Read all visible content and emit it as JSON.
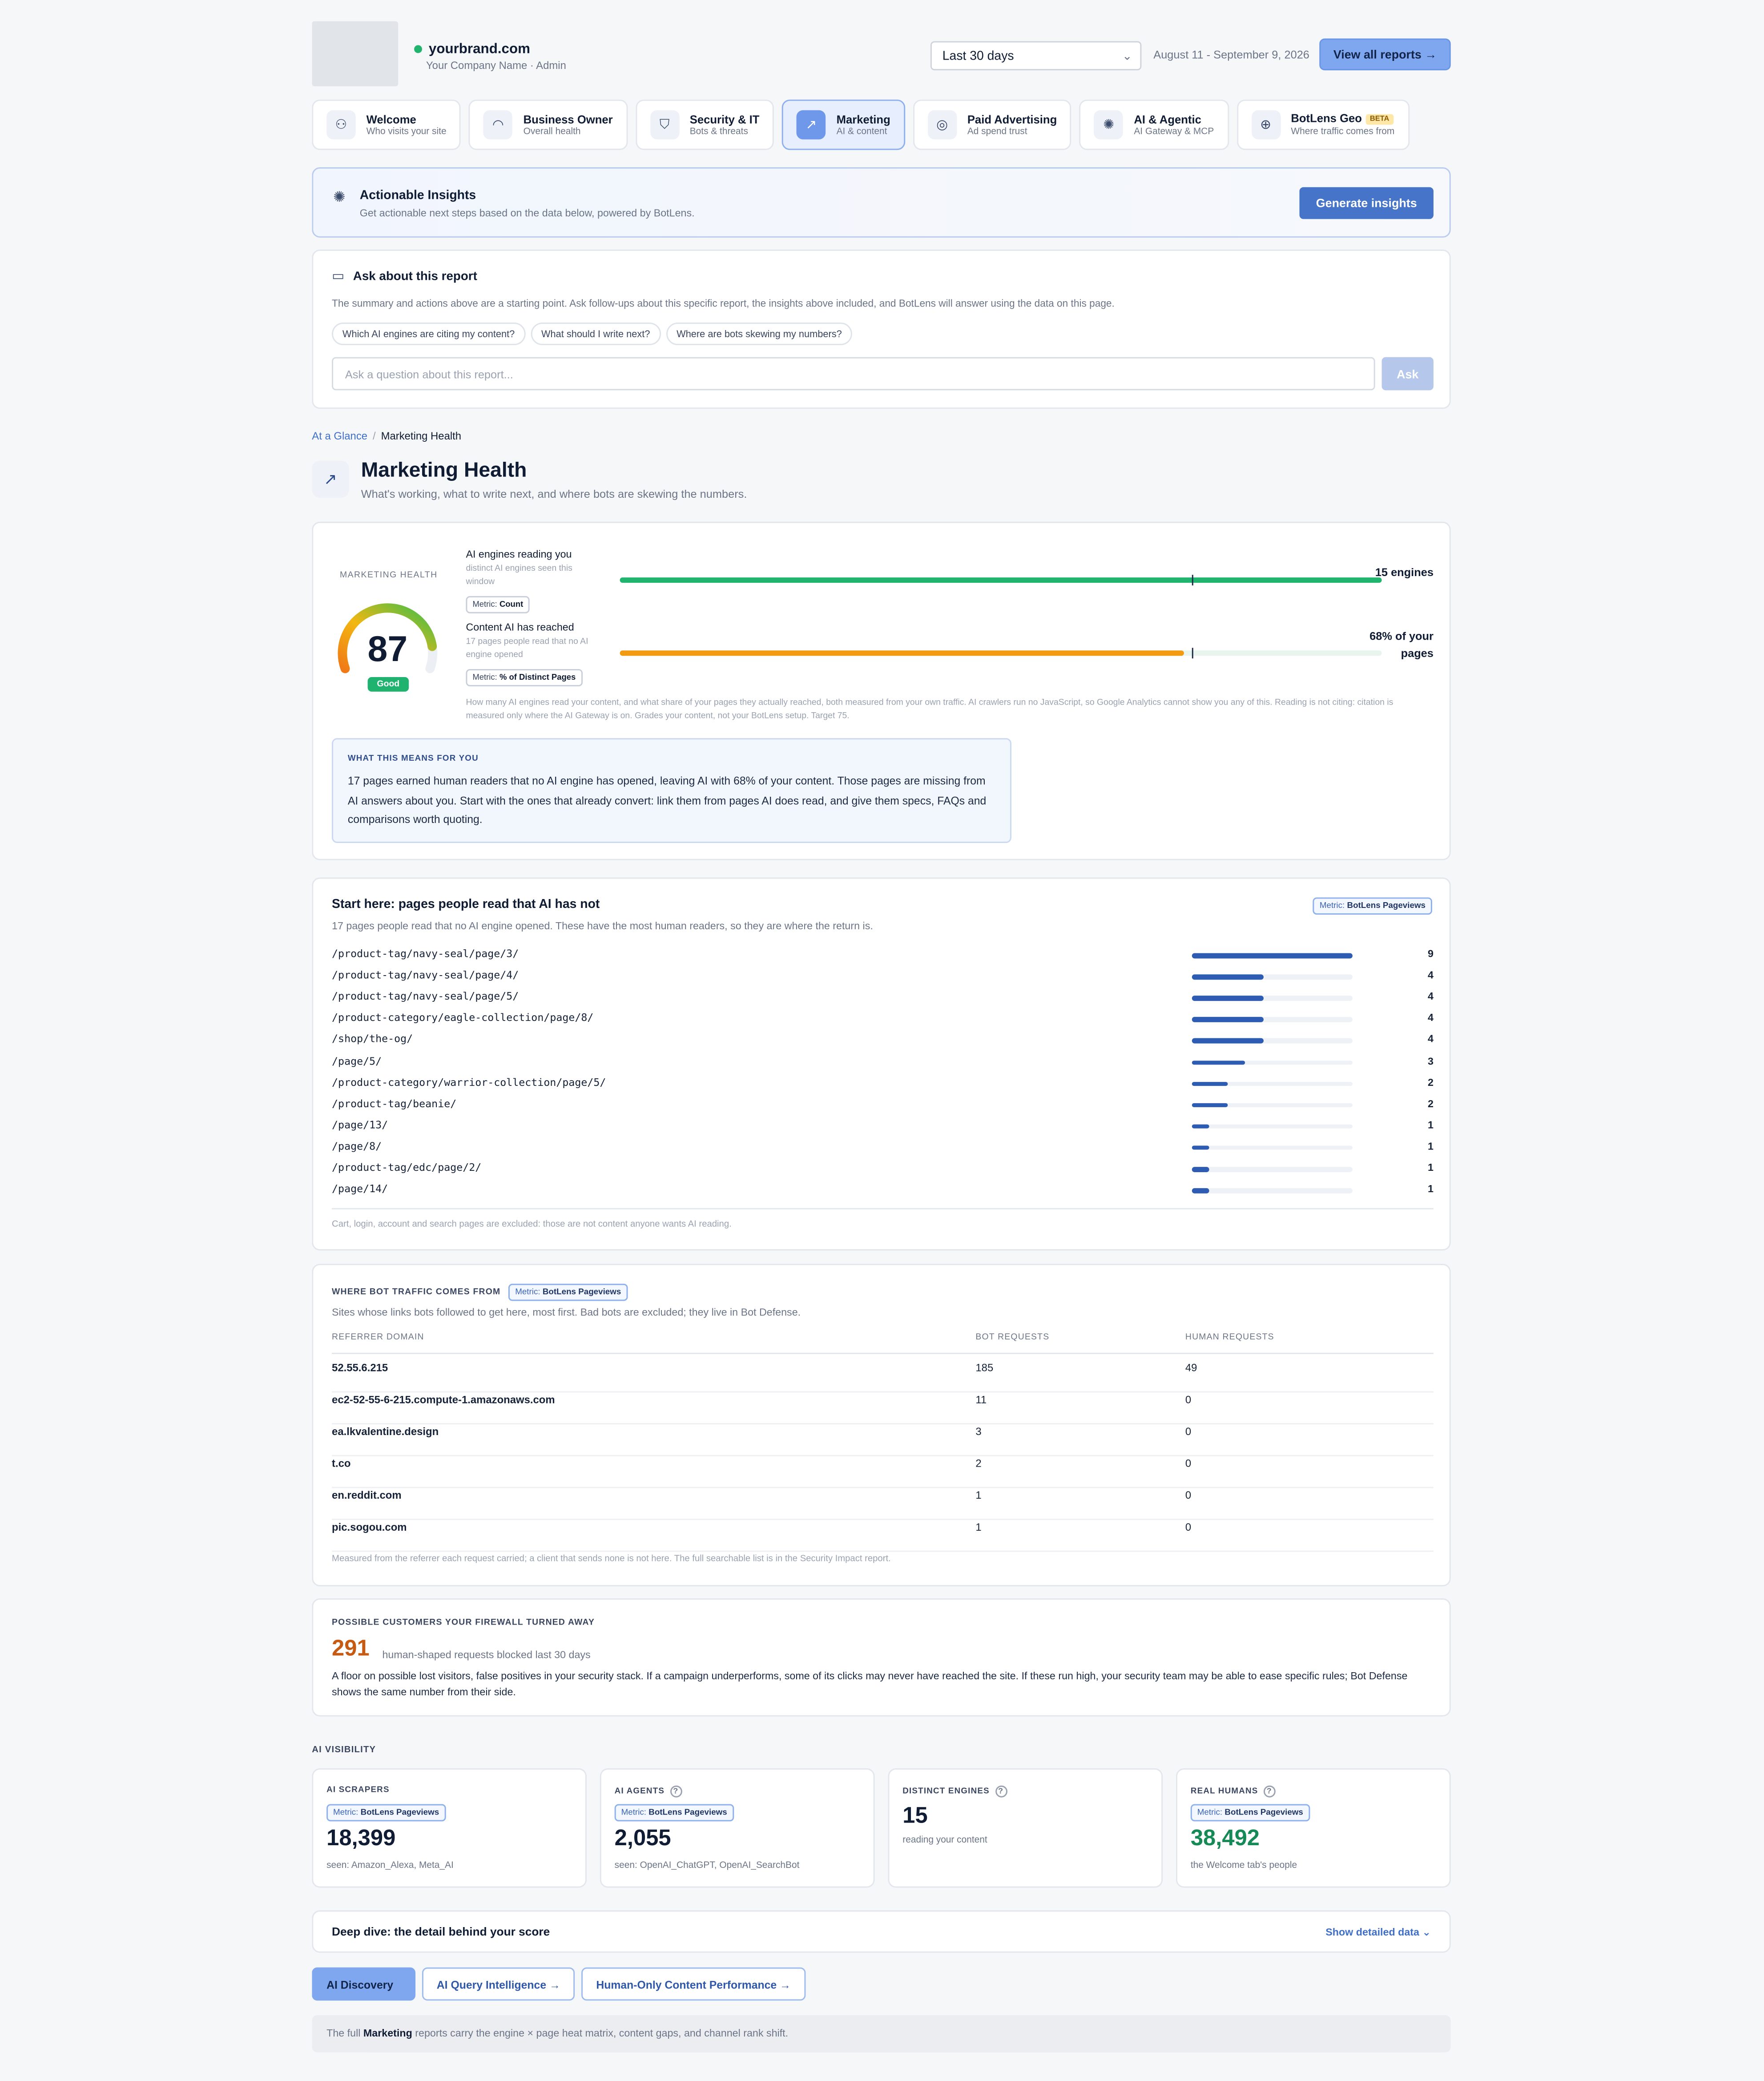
{
  "header": {
    "brand": "yourbrand.com",
    "company": "Your Company Name · Admin",
    "range_select": "Last 30 days",
    "date_range": "August 11 - September 9, 2026",
    "view_all": "View all reports →"
  },
  "tabs": [
    {
      "title": "Welcome",
      "sub": "Who visits your site",
      "icon": "users-icon"
    },
    {
      "title": "Business Owner",
      "sub": "Overall health",
      "icon": "gauge-icon"
    },
    {
      "title": "Security & IT",
      "sub": "Bots & threats",
      "icon": "shield-icon"
    },
    {
      "title": "Marketing",
      "sub": "AI & content",
      "icon": "trend-icon",
      "active": true
    },
    {
      "title": "Paid Advertising",
      "sub": "Ad spend trust",
      "icon": "target-icon"
    },
    {
      "title": "AI & Agentic",
      "sub": "AI Gateway & MCP",
      "icon": "sparkle-icon"
    },
    {
      "title": "BotLens Geo",
      "sub": "Where traffic comes from",
      "icon": "globe-icon",
      "badge": "BETA"
    }
  ],
  "insights": {
    "title": "Actionable Insights",
    "sub": "Get actionable next steps based on the data below, powered by BotLens.",
    "button": "Generate insights"
  },
  "ask": {
    "title": "Ask about this report",
    "desc": "The summary and actions above are a starting point. Ask follow-ups about this specific report, the insights above included, and BotLens will answer using the data on this page.",
    "chips": [
      "Which AI engines are citing my content?",
      "What should I write next?",
      "Where are bots skewing my numbers?"
    ],
    "placeholder": "Ask a question about this report...",
    "button": "Ask"
  },
  "breadcrumb": {
    "root": "At a Glance",
    "sep": "/",
    "current": "Marketing Health"
  },
  "page": {
    "title": "Marketing Health",
    "sub": "What's working, what to write next, and where bots are skewing the numbers."
  },
  "health": {
    "label": "MARKETING HEALTH",
    "score": "87",
    "score_value": 87,
    "rating": "Good",
    "metrics": [
      {
        "title": "AI engines reading you",
        "sub": "distinct AI engines seen this window",
        "tag_k": "Metric:",
        "tag_v": "Count",
        "value": "15 engines",
        "fill": 1.0,
        "target": 0.75,
        "color": "#20b46e"
      },
      {
        "title": "Content AI has reached",
        "sub": "17 pages people read that no AI engine opened",
        "tag_k": "Metric:",
        "tag_v": "% of Distinct Pages",
        "value": "68% of your pages",
        "fill": 0.74,
        "target": 0.75,
        "color": "#f29b11"
      }
    ],
    "foot": "How many AI engines read your content, and what share of your pages they actually reached, both measured from your own traffic. AI crawlers run no JavaScript, so Google Analytics cannot show you any of this. Reading is not citing: citation is measured only where the AI Gateway is on. Grades your content, not your BotLens setup. Target 75.",
    "means_h": "WHAT THIS MEANS FOR YOU",
    "means_t": "17 pages earned human readers that no AI engine has opened, leaving AI with 68% of your content. Those pages are missing from AI answers about you. Start with the ones that already convert: link them from pages AI does read, and give them specs, FAQs and comparisons worth quoting."
  },
  "start": {
    "title": "Start here: pages people read that AI has not",
    "sub": "17 pages people read that no AI engine opened. These have the most human readers, so they are where the return is.",
    "tag_k": "Metric:",
    "tag_v": "BotLens Pageviews",
    "max": 9,
    "rows": [
      {
        "path": "/product-tag/navy-seal/page/3/",
        "value": 9
      },
      {
        "path": "/product-tag/navy-seal/page/4/",
        "value": 4
      },
      {
        "path": "/product-tag/navy-seal/page/5/",
        "value": 4
      },
      {
        "path": "/product-category/eagle-collection/page/8/",
        "value": 4
      },
      {
        "path": "/shop/the-og/",
        "value": 4
      },
      {
        "path": "/page/5/",
        "value": 3
      },
      {
        "path": "/product-category/warrior-collection/page/5/",
        "value": 2
      },
      {
        "path": "/product-tag/beanie/",
        "value": 2
      },
      {
        "path": "/page/13/",
        "value": 1
      },
      {
        "path": "/page/8/",
        "value": 1
      },
      {
        "path": "/product-tag/edc/page/2/",
        "value": 1
      },
      {
        "path": "/page/14/",
        "value": 1
      }
    ],
    "foot": "Cart, login, account and search pages are excluded: those are not content anyone wants AI reading."
  },
  "bot": {
    "heading": "WHERE BOT TRAFFIC COMES FROM",
    "tag_k": "Metric:",
    "tag_v": "BotLens Pageviews",
    "sub": "Sites whose links bots followed to get here, most first. Bad bots are excluded; they live in Bot Defense.",
    "cols": [
      "REFERRER DOMAIN",
      "BOT REQUESTS",
      "HUMAN REQUESTS"
    ],
    "rows": [
      {
        "domain": "52.55.6.215",
        "bot": "185",
        "human": "49"
      },
      {
        "domain": "ec2-52-55-6-215.compute-1.amazonaws.com",
        "bot": "11",
        "human": "0"
      },
      {
        "domain": "ea.lkvalentine.design",
        "bot": "3",
        "human": "0"
      },
      {
        "domain": "t.co",
        "bot": "2",
        "human": "0"
      },
      {
        "domain": "en.reddit.com",
        "bot": "1",
        "human": "0"
      },
      {
        "domain": "pic.sogou.com",
        "bot": "1",
        "human": "0"
      }
    ],
    "foot": "Measured from the referrer each request carried; a client that sends none is not here. The full searchable list is in the Security Impact report."
  },
  "firewall": {
    "heading": "POSSIBLE CUSTOMERS YOUR FIREWALL TURNED AWAY",
    "number": "291",
    "unit": "human-shaped requests blocked last 30 days",
    "text": "A floor on possible lost visitors, false positives in your security stack. If a campaign underperforms, some of its clicks may never have reached the site. If these run high, your security team may be able to ease specific rules; Bot Defense shows the same number from their side."
  },
  "ai_visibility": {
    "heading": "AI VISIBILITY",
    "cards": [
      {
        "k": "AI SCRAPERS",
        "tag_k": "Metric:",
        "tag_v": "BotLens Pageviews",
        "v": "18,399",
        "s": "seen: Amazon_Alexa, Meta_AI"
      },
      {
        "k": "AI AGENTS",
        "tag_k": "Metric:",
        "tag_v": "BotLens Pageviews",
        "v": "2,055",
        "s": "seen: OpenAI_ChatGPT, OpenAI_SearchBot",
        "q": "?"
      },
      {
        "k": "DISTINCT ENGINES",
        "v": "15",
        "s": "reading your content",
        "q": "?"
      },
      {
        "k": "REAL HUMANS",
        "tag_k": "Metric:",
        "tag_v": "BotLens Pageviews",
        "v": "38,492",
        "s": "the Welcome tab's people",
        "q": "?"
      }
    ]
  },
  "deep": {
    "title": "Deep dive: the detail behind your score",
    "action": "Show detailed data ⌄"
  },
  "bottom_tabs": [
    "AI Discovery",
    "AI Query Intelligence →",
    "Human-Only Content Performance →"
  ],
  "foot_note": {
    "pre": "The full ",
    "bold": "Marketing",
    "post": " reports carry the engine × page heat matrix, content gaps, and channel rank shift."
  }
}
